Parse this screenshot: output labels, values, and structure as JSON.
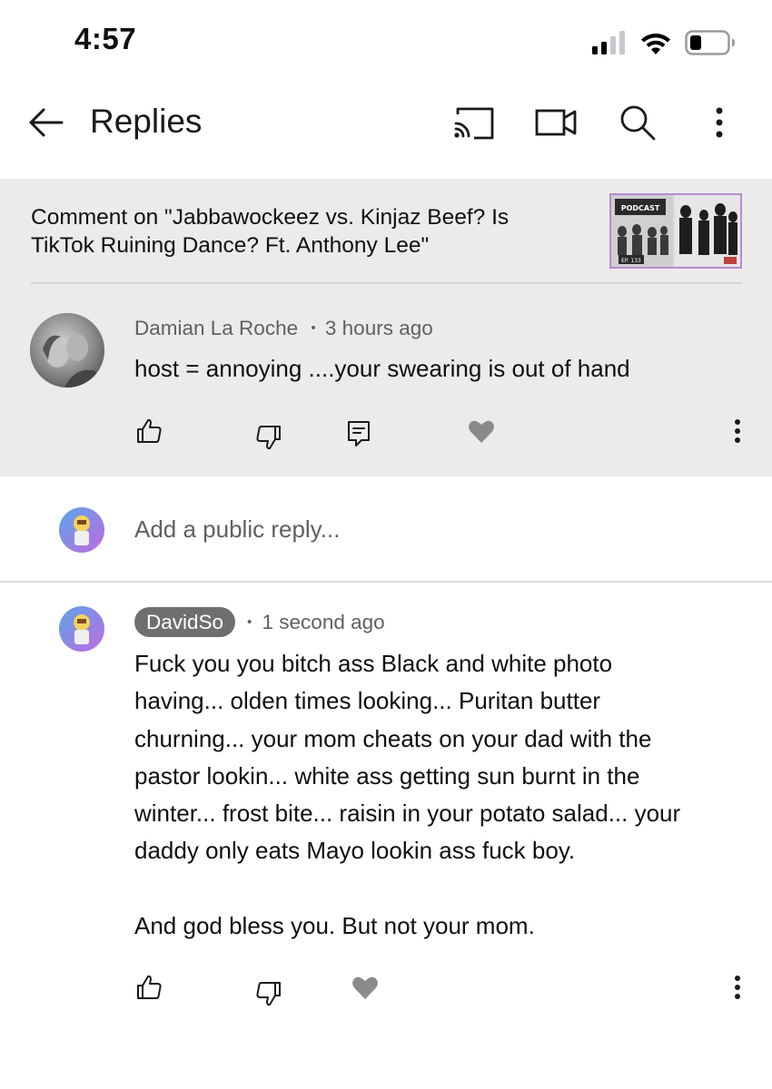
{
  "status_bar": {
    "time": "4:57"
  },
  "app_bar": {
    "title": "Replies"
  },
  "context": {
    "text": "Comment on \"Jabbawockeez vs. Kinjaz Beef? Is TikTok Ruining Dance? Ft. Anthony Lee\"",
    "thumbnail_caption": "PODCAST",
    "thumbnail_episode": "EP. 133"
  },
  "parent_comment": {
    "author": "Damian La Roche",
    "separator": "•",
    "time": "3 hours ago",
    "text": "host = annoying ....your swearing is out of hand"
  },
  "reply_input": {
    "placeholder": "Add a public reply..."
  },
  "reply": {
    "author": "DavidSo",
    "separator": "•",
    "time": "1 second ago",
    "text_lines": [
      "Fuck you you bitch ass Black and white photo",
      "having... olden times looking... Puritan butter",
      "churning... your mom cheats on your dad with the",
      "pastor lookin... white ass getting sun burnt in the",
      "winter... frost bite... raisin in your potato salad... your",
      "daddy only eats Mayo lookin ass fuck boy.",
      "",
      "And god bless you. But not your mom."
    ]
  },
  "icons": {
    "status": [
      "signal-icon",
      "wifi-icon",
      "battery-icon"
    ],
    "app_bar": [
      "back-arrow-icon",
      "cast-icon",
      "video-camera-icon",
      "search-icon",
      "more-vert-icon"
    ],
    "comment_actions": [
      "thumbs-up-icon",
      "thumbs-down-icon",
      "reply-icon",
      "heart-icon",
      "more-vert-icon"
    ]
  },
  "colors": {
    "parent_background": "#ebebeb",
    "heart": "#8a8a8a",
    "author_pill": "#6f6f6f",
    "meta_text": "#606060",
    "thumbnail_border": "#b889d6"
  }
}
